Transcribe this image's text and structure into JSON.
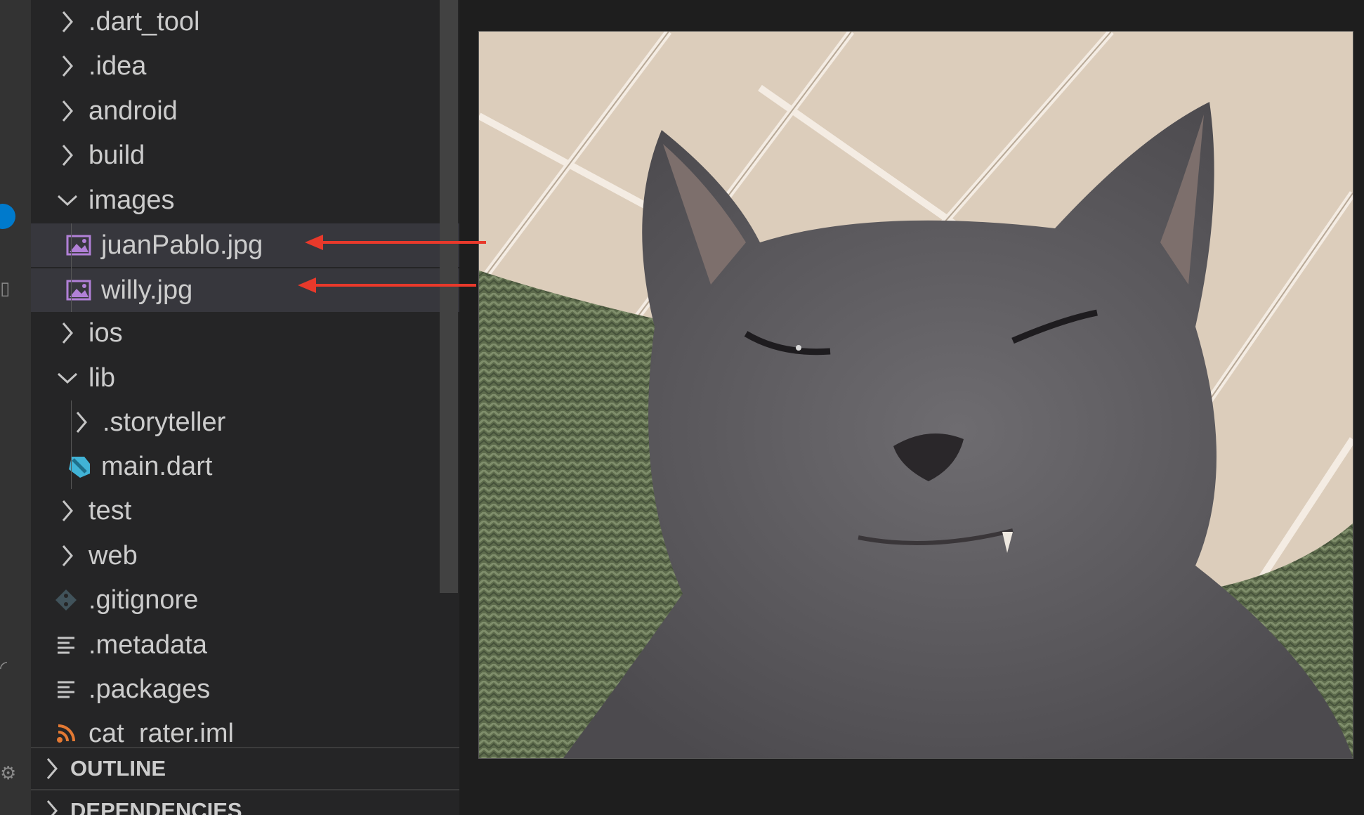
{
  "explorer": {
    "tree": [
      {
        "label": ".dart_tool",
        "kind": "folder",
        "expanded": false,
        "depth": 0
      },
      {
        "label": ".idea",
        "kind": "folder",
        "expanded": false,
        "depth": 0
      },
      {
        "label": "android",
        "kind": "folder",
        "expanded": false,
        "depth": 0
      },
      {
        "label": "build",
        "kind": "folder",
        "expanded": false,
        "depth": 0
      },
      {
        "label": "images",
        "kind": "folder",
        "expanded": true,
        "depth": 0
      },
      {
        "label": "juanPablo.jpg",
        "kind": "image",
        "depth": 1,
        "selected": true
      },
      {
        "label": "willy.jpg",
        "kind": "image",
        "depth": 1,
        "selected": true
      },
      {
        "label": "ios",
        "kind": "folder",
        "expanded": false,
        "depth": 0
      },
      {
        "label": "lib",
        "kind": "folder",
        "expanded": true,
        "depth": 0
      },
      {
        "label": ".storyteller",
        "kind": "folder",
        "expanded": false,
        "depth": 1
      },
      {
        "label": "main.dart",
        "kind": "dart",
        "depth": 1
      },
      {
        "label": "test",
        "kind": "folder",
        "expanded": false,
        "depth": 0
      },
      {
        "label": "web",
        "kind": "folder",
        "expanded": false,
        "depth": 0
      },
      {
        "label": ".gitignore",
        "kind": "git",
        "depth": 0
      },
      {
        "label": ".metadata",
        "kind": "text",
        "depth": 0
      },
      {
        "label": ".packages",
        "kind": "text",
        "depth": 0
      },
      {
        "label": "cat_rater.iml",
        "kind": "rss",
        "depth": 0
      }
    ],
    "sections": [
      {
        "label": "OUTLINE"
      },
      {
        "label": "DEPENDENCIES"
      }
    ]
  },
  "colors": {
    "arrow": "#e8392b",
    "image_icon": "#b180d7",
    "dart_icon": "#41b3d6",
    "rss_icon": "#e37933",
    "git_icon": "#41535b"
  }
}
